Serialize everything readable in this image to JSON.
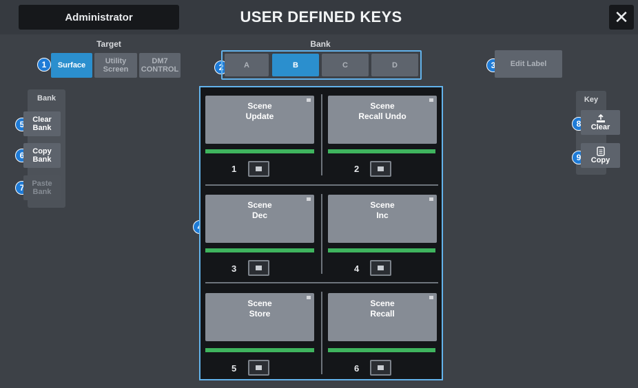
{
  "header": {
    "user": "Administrator",
    "title": "USER DEFINED KEYS",
    "close": "✕"
  },
  "target": {
    "label": "Target",
    "options": [
      {
        "label": "Surface",
        "state": "active"
      },
      {
        "label": "Utility\nScreen",
        "state": "inactive"
      },
      {
        "label": "DM7\nCONTROL",
        "state": "inactive"
      }
    ]
  },
  "bank": {
    "label": "Bank",
    "tabs": [
      {
        "label": "A",
        "selected": false
      },
      {
        "label": "B",
        "selected": true
      },
      {
        "label": "C",
        "selected": false
      },
      {
        "label": "D",
        "selected": false
      }
    ]
  },
  "edit_label": "Edit Label",
  "bank_panel": {
    "label": "Bank",
    "clear": "Clear\nBank",
    "copy": "Copy\nBank",
    "paste": "Paste\nBank"
  },
  "key_panel": {
    "label": "Key",
    "clear": "Clear",
    "copy": "Copy"
  },
  "keys": [
    {
      "num": "1",
      "label": "Scene\nUpdate"
    },
    {
      "num": "2",
      "label": "Scene\nRecall Undo"
    },
    {
      "num": "3",
      "label": "Scene\nDec"
    },
    {
      "num": "4",
      "label": "Scene\nInc"
    },
    {
      "num": "5",
      "label": "Scene\nStore"
    },
    {
      "num": "6",
      "label": "Scene\nRecall"
    }
  ],
  "callouts": [
    "1",
    "2",
    "3",
    "4",
    "5",
    "6",
    "7",
    "8",
    "9"
  ],
  "colors": {
    "accent": "#2b8fce",
    "callout": "#1f7bd6",
    "indicator": "#3fb45e",
    "outline": "#63b3ec"
  }
}
